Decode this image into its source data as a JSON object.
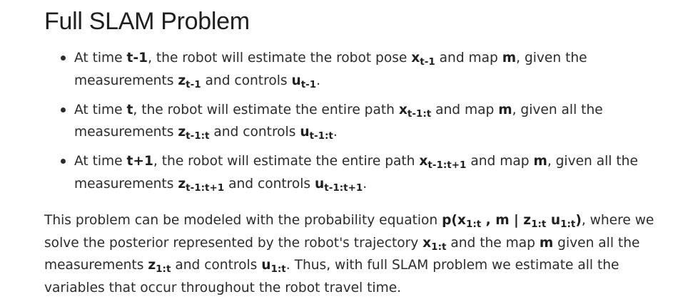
{
  "title": "Full SLAM Problem",
  "bullets": [
    {
      "t0": "At time ",
      "time": "t-1",
      "t1": ", the robot will estimate the robot pose ",
      "pose_var": "x",
      "pose_sub": "t-1",
      "t2": " and map ",
      "map_var": "m",
      "t3": ", given the measurements ",
      "meas_var": "z",
      "meas_sub": "t-1",
      "t4": " and controls ",
      "ctrl_var": "u",
      "ctrl_sub": "t-1",
      "t5": "."
    },
    {
      "t0": "At time ",
      "time": "t",
      "t1": ", the robot will estimate the entire path ",
      "pose_var": "x",
      "pose_sub": "t-1:t",
      "t2": " and map ",
      "map_var": "m",
      "t3": ", given all the measurements ",
      "meas_var": "z",
      "meas_sub": "t-1:t",
      "t4": " and controls ",
      "ctrl_var": "u",
      "ctrl_sub": "t-1:t",
      "t5": "."
    },
    {
      "t0": "At time ",
      "time": "t+1",
      "t1": ", the robot will estimate the entire path ",
      "pose_var": "x",
      "pose_sub": "t-1:t+1",
      "t2": " and map ",
      "map_var": "m",
      "t3": ", given all the measurements ",
      "meas_var": "z",
      "meas_sub": "t-1:t+1",
      "t4": " and controls ",
      "ctrl_var": "u",
      "ctrl_sub": "t-1:t+1",
      "t5": "."
    }
  ],
  "paragraph": {
    "t0": "This problem can be modeled with the probability equation ",
    "eq_p": "p(x",
    "eq_x_sub": "1:t",
    "eq_mid": " , m | z",
    "eq_z_sub": "1:t",
    "eq_u": " u",
    "eq_u_sub": "1:t",
    "eq_close": ")",
    "t1": ", where we solve the posterior represented by the robot's trajectory ",
    "traj_var": "x",
    "traj_sub": "1:t",
    "t2": " and the map ",
    "map_var": "m",
    "t3": " given all the measurements ",
    "meas_var": "z",
    "meas_sub": "1:t",
    "t4": " and controls ",
    "ctrl_var": "u",
    "ctrl_sub": "1:t",
    "t5": ". Thus, with full SLAM problem we estimate all the variables that occur throughout the robot travel time."
  }
}
